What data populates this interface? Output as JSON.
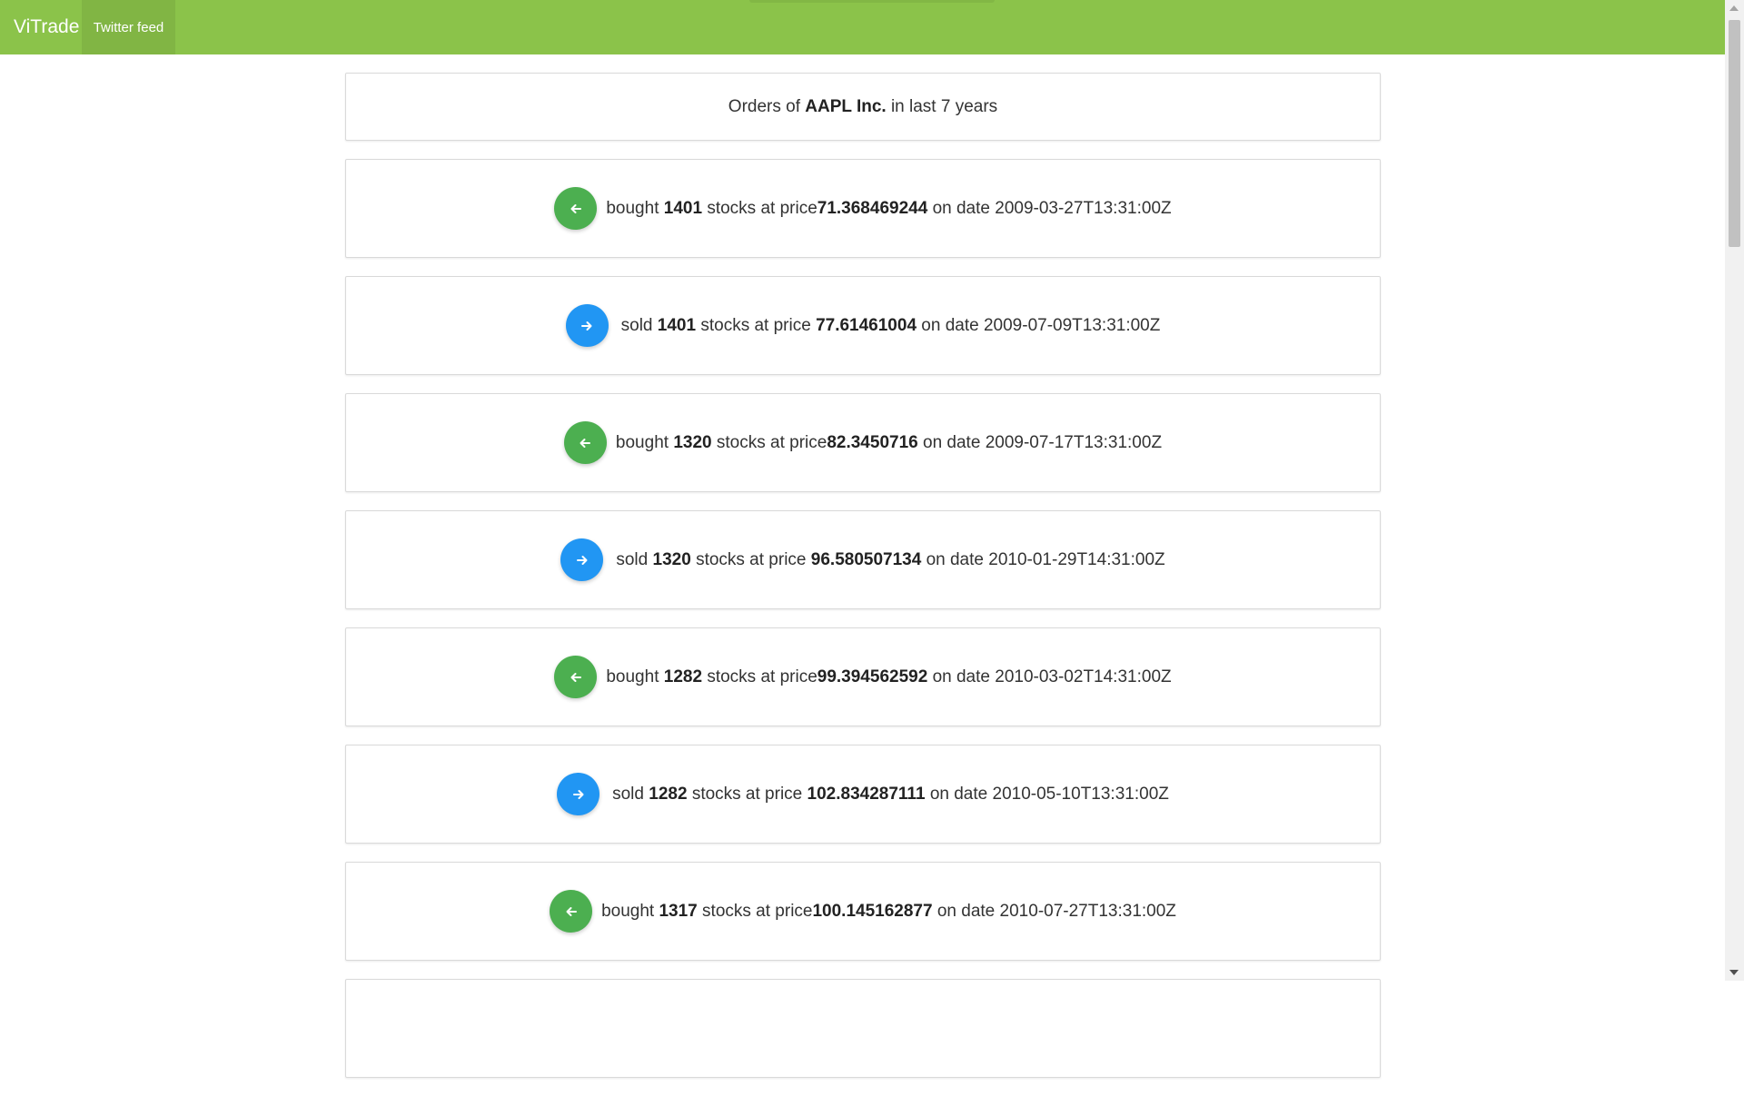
{
  "app": {
    "brand": "ViTrade",
    "nav": [
      {
        "label": "Twitter feed"
      }
    ]
  },
  "header": {
    "prefix": "Orders of",
    "company": "AAPL Inc.",
    "suffix": "in last 7 years"
  },
  "orders": [
    {
      "type": "buy",
      "action": "bought",
      "qty": "1401",
      "price_label": "stocks at price",
      "price": "71.368469244",
      "date_label": "on date",
      "date": "2009-03-27T13:31:00Z"
    },
    {
      "type": "sell",
      "action": "sold",
      "qty": "1401",
      "price_label": "stocks at price",
      "price": "77.61461004",
      "date_label": "on date",
      "date": "2009-07-09T13:31:00Z"
    },
    {
      "type": "buy",
      "action": "bought",
      "qty": "1320",
      "price_label": "stocks at price",
      "price": "82.3450716",
      "date_label": "on date",
      "date": "2009-07-17T13:31:00Z"
    },
    {
      "type": "sell",
      "action": "sold",
      "qty": "1320",
      "price_label": "stocks at price",
      "price": "96.580507134",
      "date_label": "on date",
      "date": "2010-01-29T14:31:00Z"
    },
    {
      "type": "buy",
      "action": "bought",
      "qty": "1282",
      "price_label": "stocks at price",
      "price": "99.394562592",
      "date_label": "on date",
      "date": "2010-03-02T14:31:00Z"
    },
    {
      "type": "sell",
      "action": "sold",
      "qty": "1282",
      "price_label": "stocks at price",
      "price": "102.834287111",
      "date_label": "on date",
      "date": "2010-05-10T13:31:00Z"
    },
    {
      "type": "buy",
      "action": "bought",
      "qty": "1317",
      "price_label": "stocks at price",
      "price": "100.145162877",
      "date_label": "on date",
      "date": "2010-07-27T13:31:00Z"
    }
  ],
  "icons": {
    "buy": "arrow-left-icon",
    "sell": "arrow-right-icon"
  },
  "colors": {
    "navbar": "#8bc34a",
    "buy": "#4caf50",
    "sell": "#2196f3"
  }
}
